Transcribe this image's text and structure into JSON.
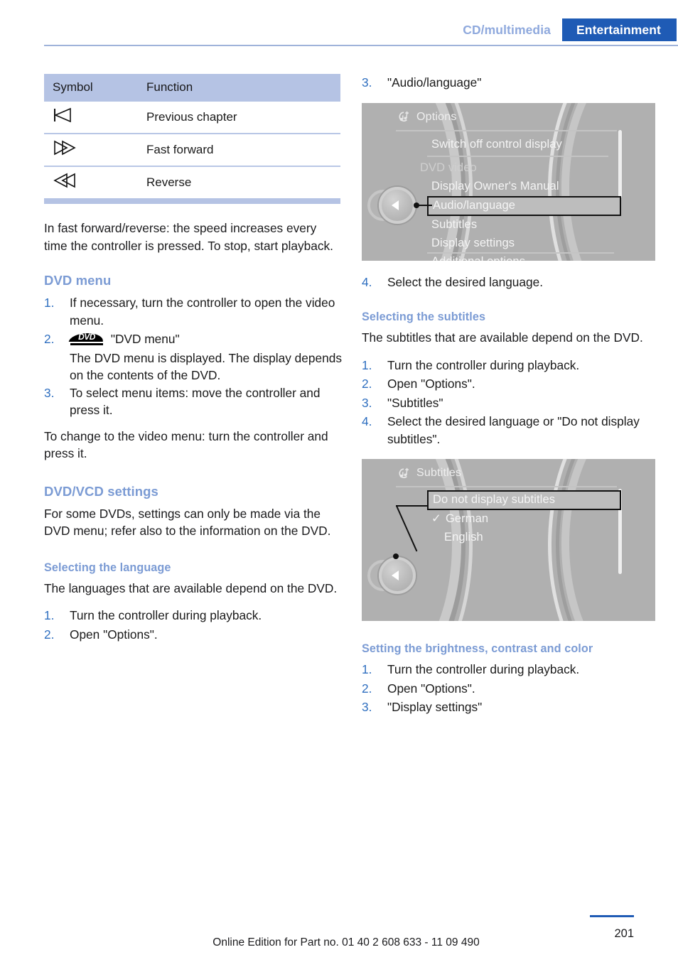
{
  "header": {
    "left_label": "CD/multimedia",
    "right_label": "Entertainment"
  },
  "symbol_table": {
    "columns": [
      "Symbol",
      "Function"
    ],
    "rows": [
      {
        "symbol_icon": "previous-chapter-icon",
        "function": "Previous chapter"
      },
      {
        "symbol_icon": "fast-forward-icon",
        "function": "Fast forward"
      },
      {
        "symbol_icon": "reverse-icon",
        "function": "Reverse"
      }
    ]
  },
  "left_column": {
    "intro_paragraph": "In fast forward/reverse: the speed increases every time the controller is pressed. To stop, start playback.",
    "dvd_menu": {
      "heading": "DVD menu",
      "steps": [
        {
          "num": "1.",
          "text": "If necessary, turn the controller to open the video menu."
        },
        {
          "num": "2.",
          "text": "\"DVD menu\"",
          "icon": "dvd-logo-icon",
          "sub": "The DVD menu is displayed. The display depends on the contents of the DVD."
        },
        {
          "num": "3.",
          "text": "To select menu items: move the controller and press it."
        }
      ],
      "closing_paragraph": "To change to the video menu: turn the controller and press it."
    },
    "dvd_vcd_settings": {
      "heading": "DVD/VCD settings",
      "paragraph": "For some DVDs, settings can only be made via the DVD menu; refer also to the information on the DVD."
    },
    "selecting_language": {
      "heading": "Selecting the language",
      "paragraph": "The languages that are available depend on the DVD.",
      "steps": [
        {
          "num": "1.",
          "text": "Turn the controller during playback."
        },
        {
          "num": "2.",
          "text": "Open \"Options\"."
        }
      ]
    }
  },
  "right_column": {
    "step3_audio_language": {
      "num": "3.",
      "text": "\"Audio/language\""
    },
    "options_screenshot": {
      "title": "Options",
      "title_icon": "options-menu-icon",
      "items": [
        {
          "label": "Switch off control display",
          "state": "normal"
        },
        {
          "label": "DVD video",
          "state": "dim"
        },
        {
          "label": "Display Owner's Manual",
          "state": "normal"
        },
        {
          "label": "Audio/language",
          "state": "selected"
        },
        {
          "label": "Subtitles",
          "state": "normal"
        },
        {
          "label": "Display settings",
          "state": "normal"
        },
        {
          "label": "Additional options",
          "state": "normal"
        }
      ],
      "controller_icon": "idrive-controller-icon"
    },
    "step4_select_language": {
      "num": "4.",
      "text": "Select the desired language."
    },
    "selecting_subtitles": {
      "heading": "Selecting the subtitles",
      "paragraph": "The subtitles that are available depend on the DVD.",
      "steps": [
        {
          "num": "1.",
          "text": "Turn the controller during playback."
        },
        {
          "num": "2.",
          "text": "Open \"Options\"."
        },
        {
          "num": "3.",
          "text": "\"Subtitles\""
        },
        {
          "num": "4.",
          "text": "Select the desired language or \"Do not display subtitles\"."
        }
      ]
    },
    "subtitles_screenshot": {
      "title": "Subtitles",
      "title_icon": "options-menu-icon",
      "items": [
        {
          "label": "Do not display subtitles",
          "state": "selected",
          "check": ""
        },
        {
          "label": "German",
          "state": "normal",
          "check": "✓"
        },
        {
          "label": "English",
          "state": "normal",
          "check": ""
        }
      ],
      "controller_icon": "idrive-controller-icon"
    },
    "setting_brightness": {
      "heading": "Setting the brightness, contrast and color",
      "steps": [
        {
          "num": "1.",
          "text": "Turn the controller during playback."
        },
        {
          "num": "2.",
          "text": "Open \"Options\"."
        },
        {
          "num": "3.",
          "text": "\"Display settings\""
        }
      ]
    }
  },
  "footer": {
    "edition_text": "Online Edition for Part no. 01 40 2 608 633 - 11 09 490",
    "page_number": "201"
  },
  "colors": {
    "accent_blue": "#1f5bb5",
    "heading_blue": "#7b9bd4",
    "table_header": "#b5c3e4",
    "list_number": "#2f6fc0"
  }
}
